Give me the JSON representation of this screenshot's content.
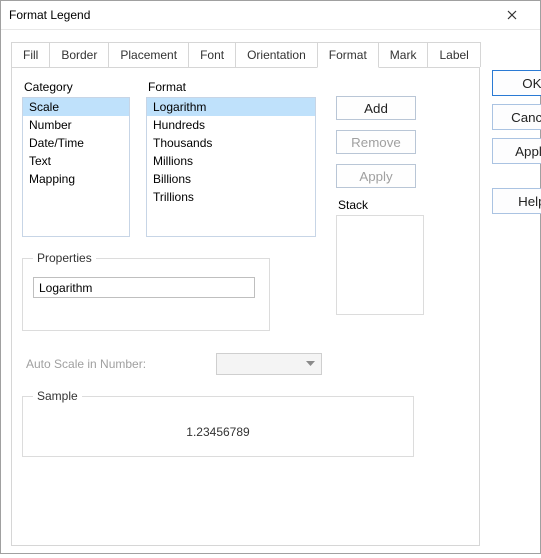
{
  "window": {
    "title": "Format Legend"
  },
  "tabs": {
    "items": [
      {
        "label": "Fill"
      },
      {
        "label": "Border"
      },
      {
        "label": "Placement"
      },
      {
        "label": "Font"
      },
      {
        "label": "Orientation"
      },
      {
        "label": "Format"
      },
      {
        "label": "Mark"
      },
      {
        "label": "Label"
      }
    ],
    "active_index": 5
  },
  "category": {
    "label": "Category",
    "items": [
      "Scale",
      "Number",
      "Date/Time",
      "Text",
      "Mapping"
    ],
    "selected_index": 0
  },
  "format": {
    "label": "Format",
    "items": [
      "Logarithm",
      "Hundreds",
      "Thousands",
      "Millions",
      "Billions",
      "Trillions"
    ],
    "selected_index": 0
  },
  "actions": {
    "add": "Add",
    "remove": "Remove",
    "apply": "Apply"
  },
  "properties": {
    "legend": "Properties",
    "value": "Logarithm"
  },
  "stack": {
    "label": "Stack"
  },
  "autoscale": {
    "label": "Auto Scale in Number:",
    "value": ""
  },
  "sample": {
    "legend": "Sample",
    "value": "1.23456789"
  },
  "side": {
    "ok": "OK",
    "cancel": "Cancel",
    "apply": "Apply",
    "help": "Help"
  }
}
